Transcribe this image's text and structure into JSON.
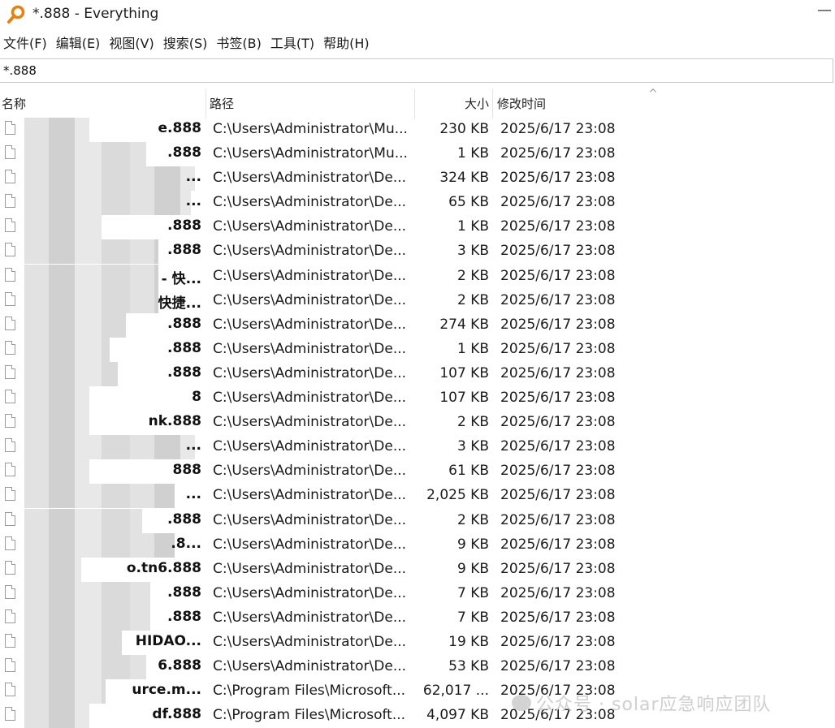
{
  "window": {
    "title": "*.888 - Everything",
    "app_icon": "magnifier-icon",
    "accent_color": "#e8820c"
  },
  "menu": [
    "文件(F)",
    "编辑(E)",
    "视图(V)",
    "搜索(S)",
    "书签(B)",
    "工具(T)",
    "帮助(H)"
  ],
  "search": {
    "value": "*.888"
  },
  "columns": {
    "name": "名称",
    "path": "路径",
    "size": "大小",
    "modified": "修改时间"
  },
  "rows": [
    {
      "name": "e.888",
      "path": "C:\\Users\\Administrator\\Mu...",
      "size": "230 KB",
      "modified": "2025/6/17 23:08"
    },
    {
      "name": ".888",
      "path": "C:\\Users\\Administrator\\Mu...",
      "size": "1 KB",
      "modified": "2025/6/17 23:08"
    },
    {
      "name": "...",
      "path": "C:\\Users\\Administrator\\De...",
      "size": "324 KB",
      "modified": "2025/6/17 23:08"
    },
    {
      "name": "...",
      "path": "C:\\Users\\Administrator\\De...",
      "size": "65 KB",
      "modified": "2025/6/17 23:08"
    },
    {
      "name": ".888",
      "path": "C:\\Users\\Administrator\\De...",
      "size": "1 KB",
      "modified": "2025/6/17 23:08"
    },
    {
      "name": ".888",
      "path": "C:\\Users\\Administrator\\De...",
      "size": "3 KB",
      "modified": "2025/6/17 23:08"
    },
    {
      "name": "- 快...",
      "path": "C:\\Users\\Administrator\\De...",
      "size": "2 KB",
      "modified": "2025/6/17 23:08"
    },
    {
      "name": "快捷...",
      "path": "C:\\Users\\Administrator\\De...",
      "size": "2 KB",
      "modified": "2025/6/17 23:08"
    },
    {
      "name": ".888",
      "path": "C:\\Users\\Administrator\\De...",
      "size": "274 KB",
      "modified": "2025/6/17 23:08"
    },
    {
      "name": ".888",
      "path": "C:\\Users\\Administrator\\De...",
      "size": "1 KB",
      "modified": "2025/6/17 23:08"
    },
    {
      "name": ".888",
      "path": "C:\\Users\\Administrator\\De...",
      "size": "107 KB",
      "modified": "2025/6/17 23:08"
    },
    {
      "name": "8",
      "path": "C:\\Users\\Administrator\\De...",
      "size": "107 KB",
      "modified": "2025/6/17 23:08"
    },
    {
      "name": "nk.888",
      "path": "C:\\Users\\Administrator\\De...",
      "size": "2 KB",
      "modified": "2025/6/17 23:08"
    },
    {
      "name": "...",
      "path": "C:\\Users\\Administrator\\De...",
      "size": "3 KB",
      "modified": "2025/6/17 23:08"
    },
    {
      "name": "888",
      "path": "C:\\Users\\Administrator\\De...",
      "size": "61 KB",
      "modified": "2025/6/17 23:08"
    },
    {
      "name": "...",
      "path": "C:\\Users\\Administrator\\De...",
      "size": "2,025 KB",
      "modified": "2025/6/17 23:08"
    },
    {
      "name": ".888",
      "path": "C:\\Users\\Administrator\\De...",
      "size": "2 KB",
      "modified": "2025/6/17 23:08"
    },
    {
      "name": ".8...",
      "path": "C:\\Users\\Administrator\\De...",
      "size": "9 KB",
      "modified": "2025/6/17 23:08"
    },
    {
      "name": "o.tn6.888",
      "path": "C:\\Users\\Administrator\\De...",
      "size": "9 KB",
      "modified": "2025/6/17 23:08"
    },
    {
      "name": ".888",
      "path": "C:\\Users\\Administrator\\De...",
      "size": "7 KB",
      "modified": "2025/6/17 23:08"
    },
    {
      "name": ".888",
      "path": "C:\\Users\\Administrator\\De...",
      "size": "7 KB",
      "modified": "2025/6/17 23:08"
    },
    {
      "name": "HIDAO...",
      "path": "C:\\Users\\Administrator\\De...",
      "size": "19 KB",
      "modified": "2025/6/17 23:08"
    },
    {
      "name": "6.888",
      "path": "C:\\Users\\Administrator\\De...",
      "size": "53 KB",
      "modified": "2025/6/17 23:08"
    },
    {
      "name": "urce.m...",
      "path": "C:\\Program Files\\Microsoft...",
      "size": "62,017 ...",
      "modified": "2025/6/17 23:08"
    },
    {
      "name": "df.888",
      "path": "C:\\Program Files\\Microsoft...",
      "size": "4,097 KB",
      "modified": "2025/6/17 23:08"
    }
  ],
  "watermark": "公众号 · solar应急响应团队"
}
